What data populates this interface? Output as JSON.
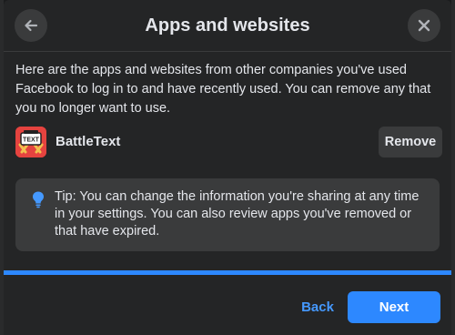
{
  "dialog": {
    "title": "Apps and websites",
    "description": "Here are the apps and websites from other companies you've used Facebook to log in to and have recently used. You can remove any that you no longer want to use."
  },
  "app": {
    "name": "BattleText",
    "logo_text": "TEXT",
    "remove_label": "Remove"
  },
  "tip": {
    "text": "Tip: You can change the information you're sharing at any time in your settings. You can also review apps you've removed or that have expired."
  },
  "progress": {
    "fraction": 1.0
  },
  "footer": {
    "back_label": "Back",
    "next_label": "Next"
  },
  "colors": {
    "dialog_bg": "#242526",
    "surface": "#3a3b3c",
    "text": "#e4e6eb",
    "accent": "#2d88ff",
    "link": "#4599ff",
    "logo_bg": "#e5433f"
  },
  "icons": {
    "back": "arrow-left-icon",
    "close": "close-icon",
    "tip": "lightbulb-icon"
  }
}
